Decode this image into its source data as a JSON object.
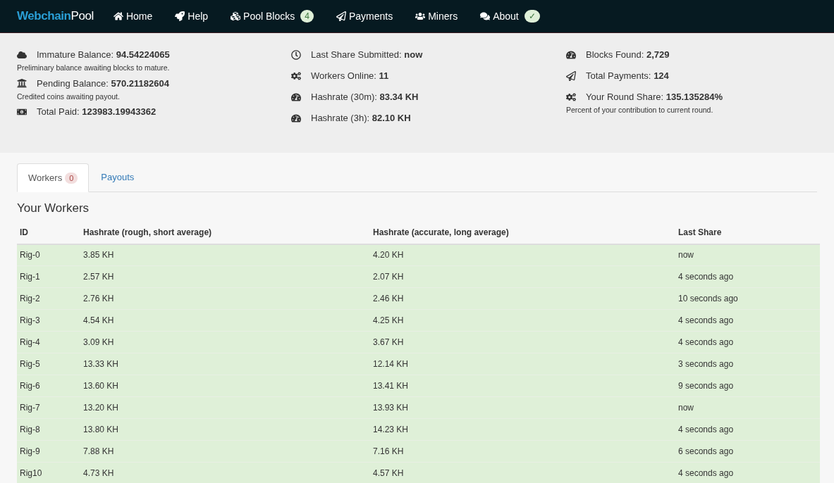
{
  "brand": {
    "first": "Webchain",
    "second": "Pool"
  },
  "nav": [
    {
      "label": "Home"
    },
    {
      "label": "Help"
    },
    {
      "label": "Pool Blocks",
      "badge": "4"
    },
    {
      "label": "Payments"
    },
    {
      "label": "Miners"
    },
    {
      "label": "About",
      "badge": "✓"
    }
  ],
  "stats": [
    [
      {
        "label": "Immature Balance:",
        "value": "94.54224065",
        "note": "Preliminary balance awaiting blocks to mature."
      },
      {
        "label": "Pending Balance:",
        "value": "570.21182604",
        "note": "Credited coins awaiting payout."
      },
      {
        "label": "Total Paid:",
        "value": "123983.19943362"
      }
    ],
    [
      {
        "label": "Last Share Submitted:",
        "value": "now"
      },
      {
        "label": "Workers Online:",
        "value": "11"
      },
      {
        "label": "Hashrate (30m):",
        "value": "83.34 KH"
      },
      {
        "label": "Hashrate (3h):",
        "value": "82.10 KH"
      }
    ],
    [
      {
        "label": "Blocks Found:",
        "value": "2,729"
      },
      {
        "label": "Total Payments:",
        "value": "124"
      },
      {
        "label": "Your Round Share:",
        "value": "135.135284%",
        "note": "Percent of your contribution to current round."
      }
    ]
  ],
  "tabs": [
    {
      "label": "Workers",
      "badge": "0",
      "selected": true
    },
    {
      "label": "Payouts",
      "selected": false
    }
  ],
  "section_title": "Your Workers",
  "table": {
    "columns": [
      "ID",
      "Hashrate (rough, short average)",
      "Hashrate (accurate, long average)",
      "Last Share"
    ],
    "rows": [
      [
        "Rig-0",
        "3.85 KH",
        "4.20 KH",
        "now"
      ],
      [
        "Rig-1",
        "2.57 KH",
        "2.07 KH",
        "4 seconds ago"
      ],
      [
        "Rig-2",
        "2.76 KH",
        "2.46 KH",
        "10 seconds ago"
      ],
      [
        "Rig-3",
        "4.54 KH",
        "4.25 KH",
        "4 seconds ago"
      ],
      [
        "Rig-4",
        "3.09 KH",
        "3.67 KH",
        "4 seconds ago"
      ],
      [
        "Rig-5",
        "13.33 KH",
        "12.14 KH",
        "3 seconds ago"
      ],
      [
        "Rig-6",
        "13.60 KH",
        "13.41 KH",
        "9 seconds ago"
      ],
      [
        "Rig-7",
        "13.20 KH",
        "13.93 KH",
        "now"
      ],
      [
        "Rig-8",
        "13.80 KH",
        "14.23 KH",
        "4 seconds ago"
      ],
      [
        "Rig-9",
        "7.88 KH",
        "7.16 KH",
        "6 seconds ago"
      ],
      [
        "Rig10",
        "4.73 KH",
        "4.57 KH",
        "4 seconds ago"
      ]
    ]
  }
}
